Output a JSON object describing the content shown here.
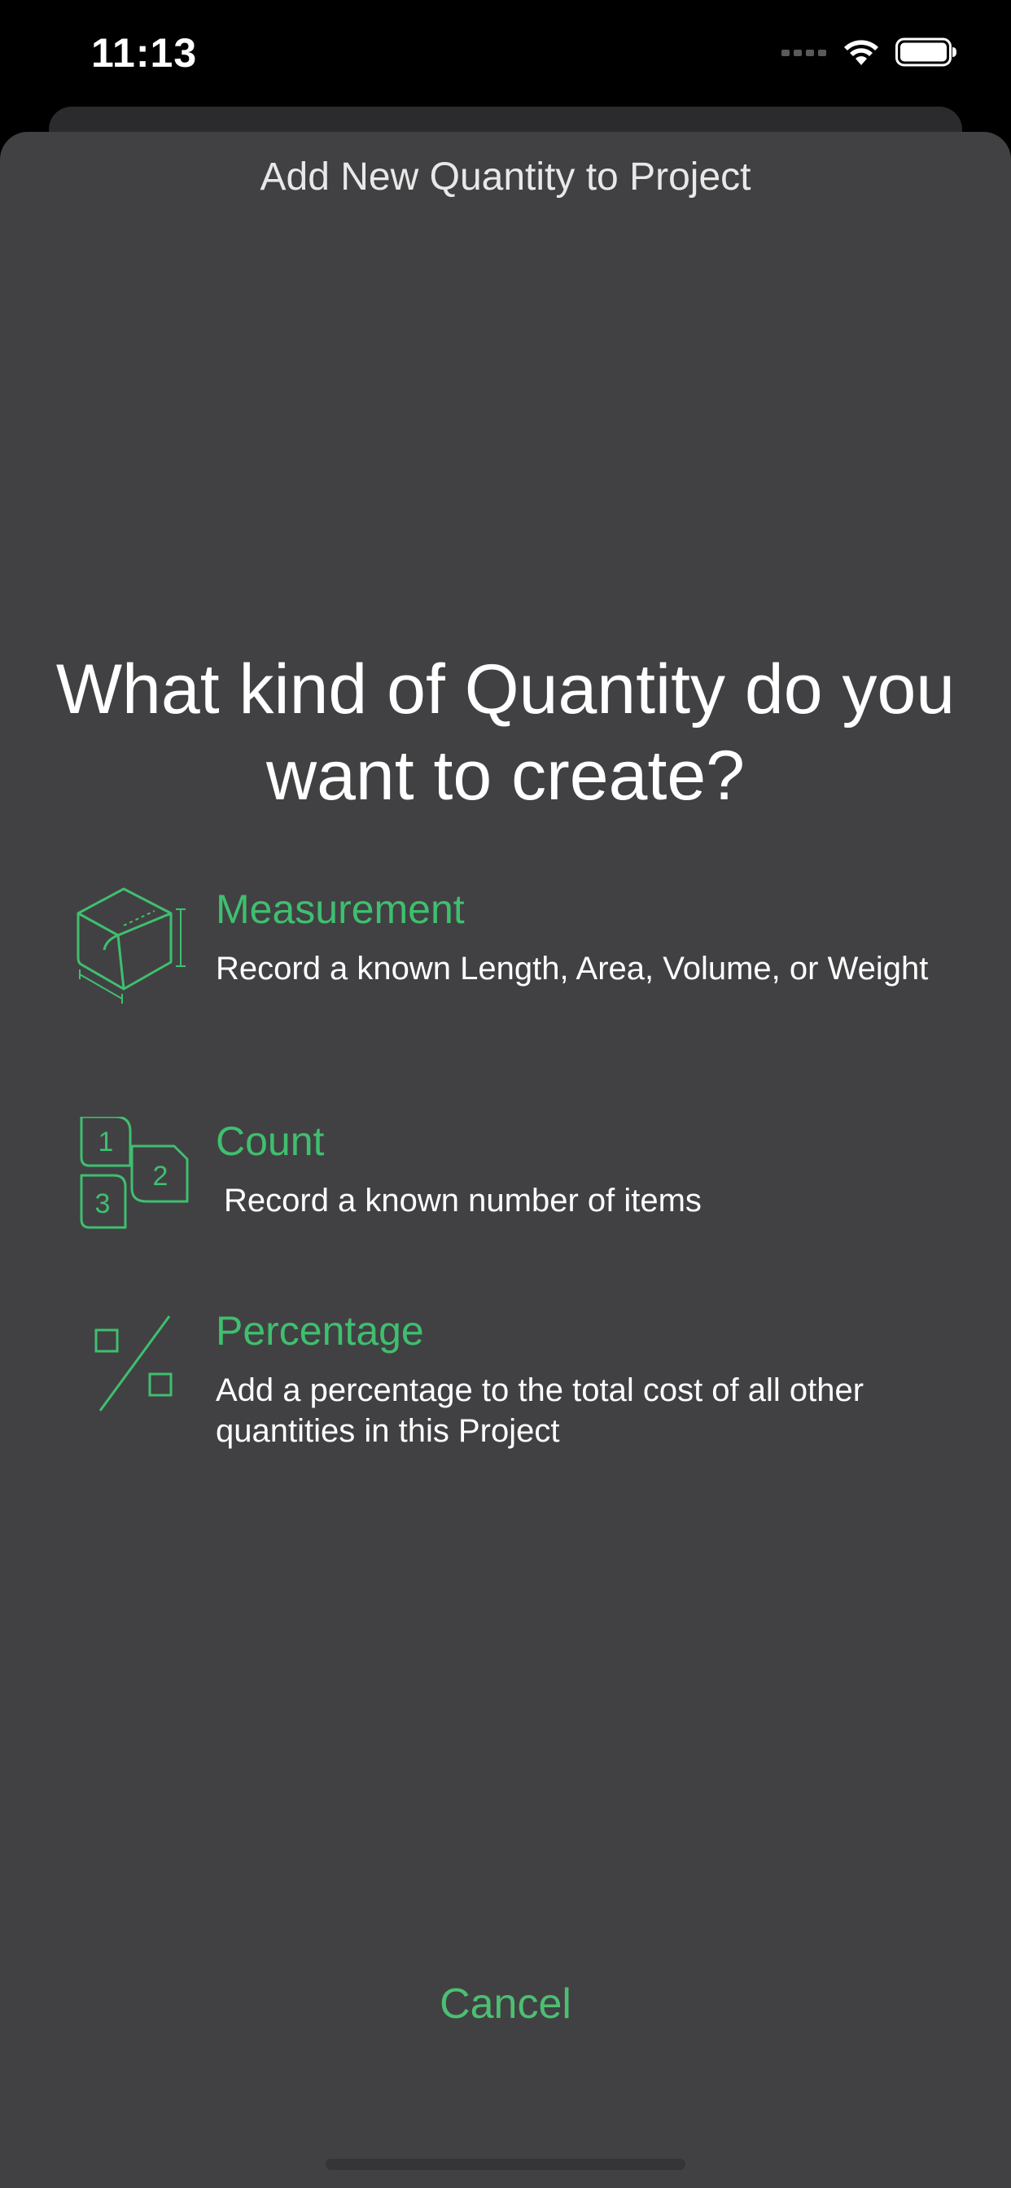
{
  "status_bar": {
    "time": "11:13"
  },
  "sheet": {
    "title": "Add New Quantity to Project",
    "question": "What kind of Quantity do you want to create?"
  },
  "options": [
    {
      "title": "Measurement",
      "description": "Record a known Length, Area, Volume, or Weight",
      "icon": "cube-measure-icon"
    },
    {
      "title": "Count",
      "description": "Record a known number of items",
      "icon": "numbered-tags-icon"
    },
    {
      "title": "Percentage",
      "description": "Add a percentage to the total cost of all other quantities in this Project",
      "icon": "percent-icon"
    }
  ],
  "count_icon_digits": [
    "1",
    "2",
    "3"
  ],
  "cancel_label": "Cancel",
  "colors": {
    "accent": "#3fbf6f",
    "sheet_background": "#414143",
    "screen_background": "#000000"
  }
}
